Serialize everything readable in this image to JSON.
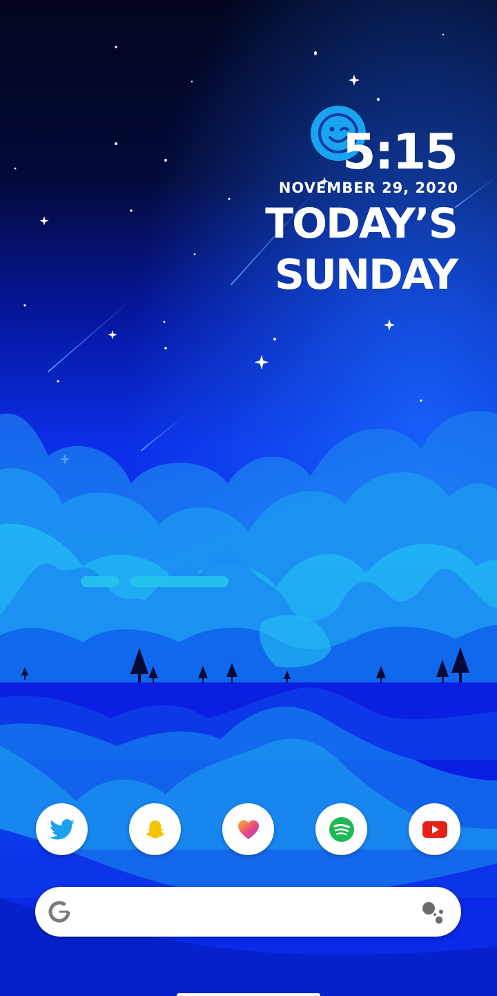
{
  "clock_widget": {
    "time": "5:15",
    "date": "NOVEMBER 29, 2020",
    "headline_line1": "TODAY’S",
    "headline_line2": "SUNDAY",
    "icon": "wink-face-icon",
    "icon_color": "#1aa3f0"
  },
  "dock": {
    "apps": [
      {
        "name": "Twitter",
        "icon": "twitter-bird-icon",
        "color": "#1da1f2"
      },
      {
        "name": "Snapchat",
        "icon": "snapchat-ghost-icon",
        "color": "#f5c400"
      },
      {
        "name": "Heart app",
        "icon": "heart-icon",
        "color": "#e2507f"
      },
      {
        "name": "Spotify",
        "icon": "spotify-icon",
        "color": "#1db954"
      },
      {
        "name": "YouTube",
        "icon": "youtube-play-icon",
        "color": "#e62117"
      }
    ]
  },
  "search_bar": {
    "logo": "google-g-icon",
    "assistant": "google-assistant-icon"
  },
  "colors": {
    "sky_top": "#02051c",
    "sky_mid": "#0a22d8",
    "cloud": "#1fb6f0",
    "foreground_text": "#ffffff"
  }
}
